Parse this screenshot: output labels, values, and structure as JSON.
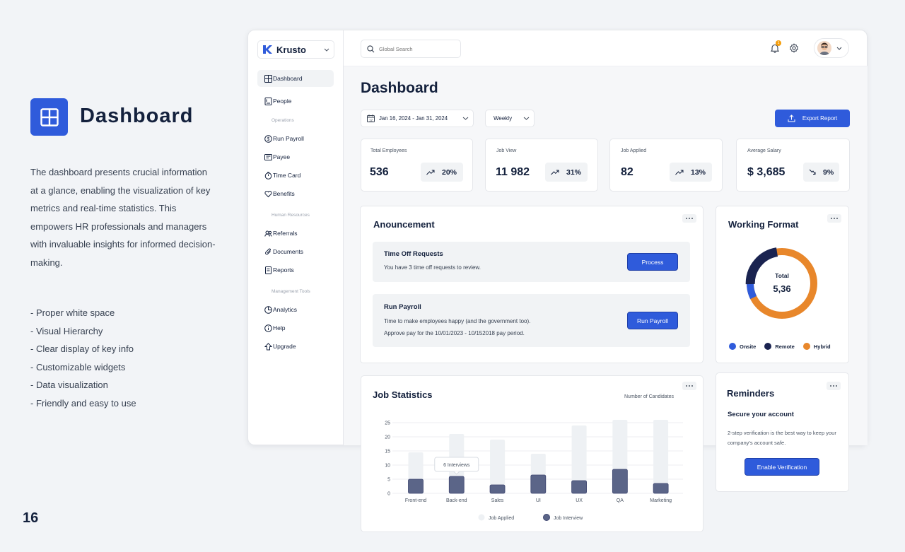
{
  "intro": {
    "title": "Dashboard",
    "description": "The dashboard presents crucial information at a glance, enabling the visualization of key metrics and real-time statistics. This empowers HR professionals and managers with invaluable insights for informed decision-making.",
    "features": [
      "- Proper white space",
      "- Visual Hierarchy",
      "- Clear display of key info",
      "- Customizable widgets",
      "- Data visualization",
      "- Friendly and easy to use"
    ],
    "page_number": "16"
  },
  "brand": {
    "name": "Krusto",
    "color": "#2f5bdb"
  },
  "sidebar": {
    "items": [
      {
        "label": "Dashboard",
        "icon": "dashboard-icon",
        "active": true
      },
      {
        "label": "People",
        "icon": "people-icon"
      }
    ],
    "sections": [
      {
        "title": "Operations",
        "items": [
          {
            "label": "Run Payroll",
            "icon": "dollar-icon"
          },
          {
            "label": "Payee",
            "icon": "payee-icon"
          },
          {
            "label": "Time Card",
            "icon": "stopwatch-icon"
          },
          {
            "label": "Benefits",
            "icon": "heart-icon"
          }
        ]
      },
      {
        "title": "Human Resources",
        "items": [
          {
            "label": "Referrals",
            "icon": "referrals-icon"
          },
          {
            "label": "Documents",
            "icon": "paperclip-icon"
          },
          {
            "label": "Reports",
            "icon": "reports-icon"
          }
        ]
      },
      {
        "title": "Management Tools",
        "items": [
          {
            "label": "Analytics",
            "icon": "analytics-icon"
          },
          {
            "label": "Help",
            "icon": "info-icon"
          },
          {
            "label": "Upgrade",
            "icon": "upgrade-icon"
          }
        ]
      }
    ]
  },
  "topbar": {
    "search_placeholder": "Global Search",
    "notification_count": "1"
  },
  "main": {
    "title": "Dashboard",
    "date_range": "Jan 16, 2024 - Jan 31, 2024",
    "period": "Weekly",
    "export_label": "Export Report"
  },
  "stats": [
    {
      "label": "Total Employees",
      "value": "536",
      "trend": "20%",
      "direction": "up"
    },
    {
      "label": "Job View",
      "value": "11 982",
      "trend": "31%",
      "direction": "up"
    },
    {
      "label": "Job Applied",
      "value": "82",
      "trend": "13%",
      "direction": "up"
    },
    {
      "label": "Average Salary",
      "value": "$ 3,685",
      "trend": "9%",
      "direction": "down"
    }
  ],
  "announcement": {
    "title": "Anouncement",
    "items": [
      {
        "title": "Time Off Requests",
        "lines": [
          "You have 3 time off requests to review."
        ],
        "button": "Process"
      },
      {
        "title": "Run Payroll",
        "lines": [
          "Time to make employees happy (and the government too).",
          "Approve pay for the 10/01/2023 - 10/152018 pay period."
        ],
        "button": "Run Payroll"
      }
    ]
  },
  "working_format": {
    "title": "Working Format",
    "total_label": "Total",
    "total_value": "5,36",
    "legend": [
      {
        "label": "Onsite",
        "color": "#2f5bdb"
      },
      {
        "label": "Remote",
        "color": "#1a2350"
      },
      {
        "label": "Hybrid",
        "color": "#e8872b"
      }
    ]
  },
  "reminders": {
    "title": "Reminders",
    "heading": "Secure your account",
    "text": "2-step verification is the best way to keep your company's account safe.",
    "button": "Enable Verification"
  },
  "chart_data": {
    "type": "bar",
    "title": "Job Statistics",
    "ylabel": "Number of Candidates",
    "categories": [
      "Front-end",
      "Back-end",
      "Sales",
      "UI",
      "UX",
      "QA",
      "Marketing"
    ],
    "series": [
      {
        "name": "Job Applied",
        "values": [
          14.5,
          21,
          19,
          14,
          24,
          26,
          26
        ],
        "color": "#eef1f4"
      },
      {
        "name": "Job Interview",
        "values": [
          5,
          6,
          3,
          6.5,
          4.5,
          8.5,
          3.5
        ],
        "color": "#5b6588"
      }
    ],
    "ylim": [
      0,
      25
    ],
    "yticks": [
      0,
      5,
      10,
      15,
      20,
      25
    ],
    "tooltip": {
      "category": "Back-end",
      "text": "6 Interviews"
    },
    "grid": true,
    "legend": "bottom"
  }
}
